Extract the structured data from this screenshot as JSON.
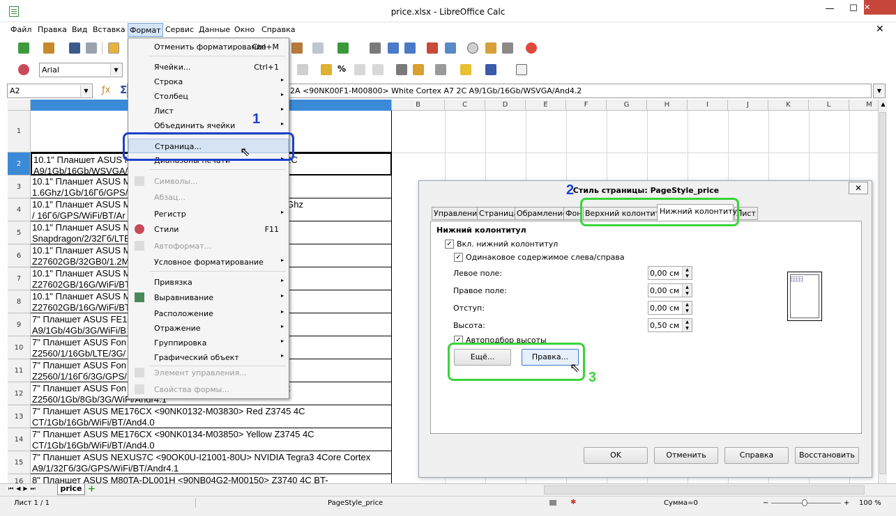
{
  "window": {
    "title": "price.xlsx - LibreOffice Calc",
    "minimize": "—",
    "maximize": "☐",
    "close": "✕"
  },
  "menubar": {
    "items": [
      "Файл",
      "Правка",
      "Вид",
      "Вставка",
      "Формат",
      "Сервис",
      "Данные",
      "Окно",
      "Справка"
    ],
    "close": "✕"
  },
  "toolbar": {
    "font_name": "Arial"
  },
  "formula": {
    "cell_ref": "A2",
    "content": "2A <90NK00F1-M00800> White Cortex A7 2C A9/1Gb/16Gb/WSVGA/And4.2"
  },
  "columns": [
    "",
    "B",
    "C",
    "D",
    "E",
    "F",
    "G",
    "H",
    "I",
    "J",
    "K",
    "L",
    "M"
  ],
  "rows": [
    {
      "num": "1",
      "text": ""
    },
    {
      "num": "2",
      "text": "10.1\" Планшет ASUS M                               > White Cortex A7 2C\nA9/1Gb/16Gb/WSVGA/"
    },
    {
      "num": "3",
      "text": "10.1\" Планшет ASUS M                             890> Gray 4Core\n1.6Ghz/1Gb/16Гб/GPS/WiFi"
    },
    {
      "num": "4",
      "text": "10.1\" Планшет ASUS M                             900> Pink 4Core 1.6Ghz\n/ 16Гб/GPS/WiFi/BT/Ar"
    },
    {
      "num": "5",
      "text": "10.1\" Планшет ASUS M                           2-M00240> Blue\nSnapdragon/2/32Гб/LTE"
    },
    {
      "num": "6",
      "text": "10.1\" Планшет ASUS M                               > White\nZ27602GB/32GB0/1.2M"
    },
    {
      "num": "7",
      "text": "10.1\" Планшет ASUS M                               > White\nZ27602GB/16G/WiFi/BT"
    },
    {
      "num": "8",
      "text": "10.1\" Планшет ASUS M                               > Black\nZ27602GB/16G/WiFi/BT"
    },
    {
      "num": "9",
      "text": "7\" Планшет ASUS FE1                              ck Z2520 4C\nA9/1Gb/4Gb/3G/WiFi/B"
    },
    {
      "num": "10",
      "text": "7\" Планшет ASUS Fon                              380> Black Atom\nZ2560/1/16Gb/LTE/3G/"
    },
    {
      "num": "11",
      "text": "7\" Планшет ASUS Fon                              White Atom\nZ2560/1/16Гб/3G/GPS/"
    },
    {
      "num": "12",
      "text": "7\" Планшет ASUS Fon                              01020> 8Gb 3G black\nZ2560/1Gb/8Gb/3G/WiFi/Andr4.1"
    },
    {
      "num": "13",
      "text": "7\" Планшет ASUS ME176CX <90NK0132-M03830> Red Z3745 4C\nCT/1Gb/16Gb/WiFi/BT/And4.0"
    },
    {
      "num": "14",
      "text": "7\" Планшет ASUS ME176CX <90NK0134-M03850> Yellow Z3745 4C\nCT/1Gb/16Gb/WiFi/BT/And4.0"
    },
    {
      "num": "15",
      "text": "7\" Планшет ASUS NEXUS7C <90OK0U-I21001-80U> NVIDIA Tegra3 4Core Cortex\nA9/1/32Гб/3G/GPS/WiFi/BT/Andr4.1"
    },
    {
      "num": "16",
      "text": "8\" Планшет ASUS M80TA-DL001H <90NB04G2-M00150> Z3740 4C BT-"
    }
  ],
  "format_menu": {
    "items": [
      {
        "label": "Отменить форматирование",
        "shortcut": "Ctrl+M"
      },
      {
        "label": "Ячейки...",
        "shortcut": "Ctrl+1"
      },
      {
        "label": "Строка",
        "arrow": "▸"
      },
      {
        "label": "Столбец",
        "arrow": "▸"
      },
      {
        "label": "Лист",
        "arrow": "▸"
      },
      {
        "label": "Объединить ячейки",
        "arrow": "▸"
      },
      {
        "label": "Страница..."
      },
      {
        "label": "Диапазоны печати",
        "arrow": "▸"
      },
      {
        "label": "Символы..."
      },
      {
        "label": "Абзац..."
      },
      {
        "label": "Регистр",
        "arrow": "▸"
      },
      {
        "label": "Стили",
        "shortcut": "F11"
      },
      {
        "label": "Автоформат..."
      },
      {
        "label": "Условное форматирование",
        "arrow": "▸"
      },
      {
        "label": "Привязка",
        "arrow": "▸"
      },
      {
        "label": "Выравнивание",
        "arrow": "▸"
      },
      {
        "label": "Расположение",
        "arrow": "▸"
      },
      {
        "label": "Отражение",
        "arrow": "▸"
      },
      {
        "label": "Группировка",
        "arrow": "▸"
      },
      {
        "label": "Графический объект",
        "arrow": "▸"
      },
      {
        "label": "Элемент управления..."
      },
      {
        "label": "Свойства формы..."
      }
    ]
  },
  "dialog": {
    "title": "Стиль страницы: PageStyle_price",
    "close": "✕",
    "tabs": [
      "Управление",
      "Страница",
      "Обрамление",
      "Фон",
      "Верхний колонтитул",
      "Нижний колонтитул",
      "Лист"
    ],
    "section": "Нижний колонтитул",
    "enable_footer": "Вкл. нижний колонтитул",
    "same_content": "Одинаковое содержимое слева/справа",
    "left_margin_label": "Левое поле:",
    "left_margin": "0,00 см",
    "right_margin_label": "Правое поле:",
    "right_margin": "0,00 см",
    "spacing_label": "Отступ:",
    "spacing": "0,00 см",
    "height_label": "Высота:",
    "height": "0,50 см",
    "autofit": "Автоподбор высоты",
    "more_button": "Ещё...",
    "edit_button": "Правка...",
    "ok": "OK",
    "cancel": "Отменить",
    "help": "Справка",
    "reset": "Восстановить"
  },
  "annotations": {
    "n1": "1",
    "n2": "2",
    "n3": "3"
  },
  "sheet_tab": "price",
  "status": {
    "sheet": "Лист 1 / 1",
    "page_style": "PageStyle_price",
    "sum": "Сумма=0",
    "zoom": "100 %"
  }
}
